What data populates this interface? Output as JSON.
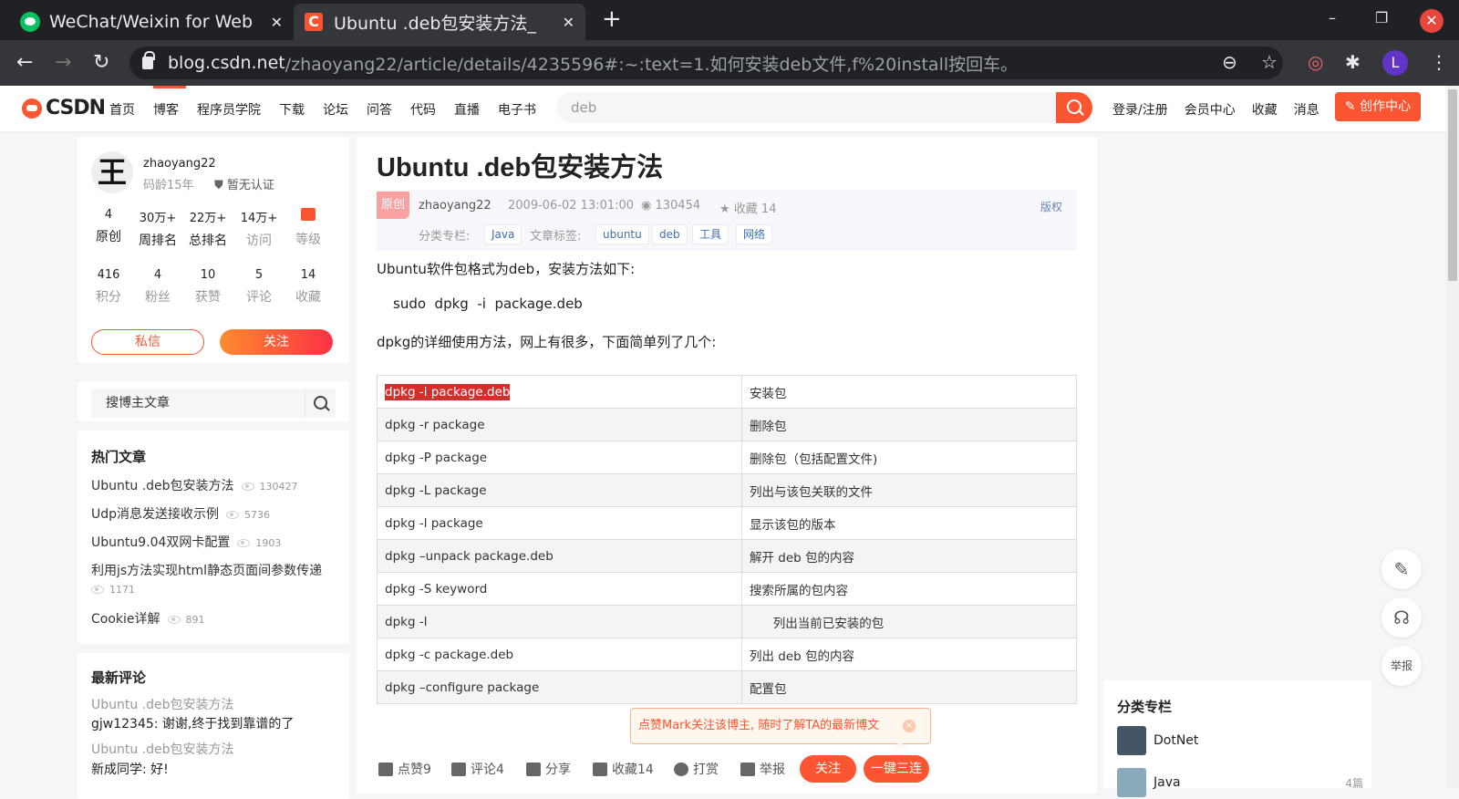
{
  "browser": {
    "tabs": [
      {
        "title": "WeChat/Weixin for Web"
      },
      {
        "title": "Ubuntu .deb包安装方法_"
      }
    ],
    "url_host": "blog.csdn.net",
    "url_path": "/zhaoyang22/article/details/4235596#:~:text=1.如何安装deb文件,f%20install按回车。",
    "profile_initial": "L",
    "new_tab": "+",
    "minimize": "–",
    "restore": "❐",
    "close": "✕"
  },
  "csdn": {
    "logo": "CSDN",
    "nav": [
      "首页",
      "博客",
      "程序员学院",
      "下载",
      "论坛",
      "问答",
      "代码",
      "直播",
      "电子书"
    ],
    "search_value": "deb",
    "right_links": [
      "登录/注册",
      "会员中心",
      "收藏",
      "消息"
    ],
    "create_label": "创作中心"
  },
  "profile": {
    "avatar_char": "王",
    "username": "zhaoyang22",
    "code_age": "码龄15年",
    "cert": "暂无认证",
    "stats1": [
      {
        "value": "4",
        "label": "原创"
      },
      {
        "value": "30万+",
        "label": "周排名"
      },
      {
        "value": "22万+",
        "label": "总排名"
      },
      {
        "value": "14万+",
        "label": "访问"
      },
      {
        "value": "",
        "label": "等级"
      }
    ],
    "stats2": [
      {
        "value": "416",
        "label": "积分"
      },
      {
        "value": "4",
        "label": "粉丝"
      },
      {
        "value": "10",
        "label": "获赞"
      },
      {
        "value": "5",
        "label": "评论"
      },
      {
        "value": "14",
        "label": "收藏"
      }
    ],
    "msg_label": "私信",
    "follow_label": "关注"
  },
  "sidebar_search": {
    "placeholder": "搜博主文章"
  },
  "hot": {
    "title": "热门文章",
    "items": [
      {
        "title": "Ubuntu .deb包安装方法",
        "views": "130427"
      },
      {
        "title": "Udp消息发送接收示例",
        "views": "5736"
      },
      {
        "title": "Ubuntu9.04双网卡配置",
        "views": "1903"
      },
      {
        "title": "利用js方法实现html静态页面间参数传递",
        "views": "1171"
      },
      {
        "title": "Cookie详解",
        "views": "891"
      }
    ]
  },
  "comments": {
    "title": "最新评论",
    "items": [
      {
        "article": "Ubuntu .deb包安装方法",
        "text": "gjw12345: 谢谢,终于找到靠谱的了"
      },
      {
        "article": "Ubuntu .deb包安装方法",
        "text": "新成同学: 好!"
      }
    ]
  },
  "article": {
    "title": "Ubuntu .deb包安装方法",
    "badge": "原创",
    "author": "zhaoyang22",
    "date": "2009-06-02 13:01:00",
    "views": "130454",
    "favs": "收藏 14",
    "copyright": "版权",
    "column_label": "分类专栏:",
    "columns": [
      "Java"
    ],
    "tags_label": "文章标签:",
    "tags": [
      "ubuntu",
      "deb",
      "工具",
      "网络"
    ],
    "p1": "Ubuntu软件包格式为deb，安装方法如下:",
    "p2": "sudo  dpkg  -i  package.deb",
    "p3": "dpkg的详细使用方法，网上有很多，下面简单列了几个:",
    "table": [
      [
        "dpkg -i package.deb",
        "安装包"
      ],
      [
        "dpkg -r package",
        "删除包"
      ],
      [
        "dpkg -P package",
        "删除包（包括配置文件)"
      ],
      [
        "dpkg -L package",
        "列出与该包关联的文件"
      ],
      [
        "dpkg -l package",
        "显示该包的版本"
      ],
      [
        "dpkg –unpack package.deb",
        "解开 deb 包的内容"
      ],
      [
        "dpkg -S keyword",
        "搜索所属的包内容"
      ],
      [
        "dpkg -l",
        "      列出当前已安装的包"
      ],
      [
        "dpkg -c package.deb",
        "列出 deb 包的内容"
      ],
      [
        "dpkg –configure package",
        "配置包"
      ]
    ],
    "follow_tip": "点赞Mark关注该博主, 随时了解TA的最新博文",
    "follow_tip_close": "×"
  },
  "actions": {
    "like": "点赞9",
    "comment": "评论4",
    "share": "分享",
    "fav": "收藏14",
    "reward": "打赏",
    "report": "举报",
    "follow": "关注",
    "triple": "一键三连"
  },
  "float": {
    "report": "举报"
  },
  "right_col": {
    "title": "分类专栏",
    "items": [
      {
        "name": "DotNet",
        "count": ""
      },
      {
        "name": "Java",
        "count": "4篇"
      }
    ]
  }
}
